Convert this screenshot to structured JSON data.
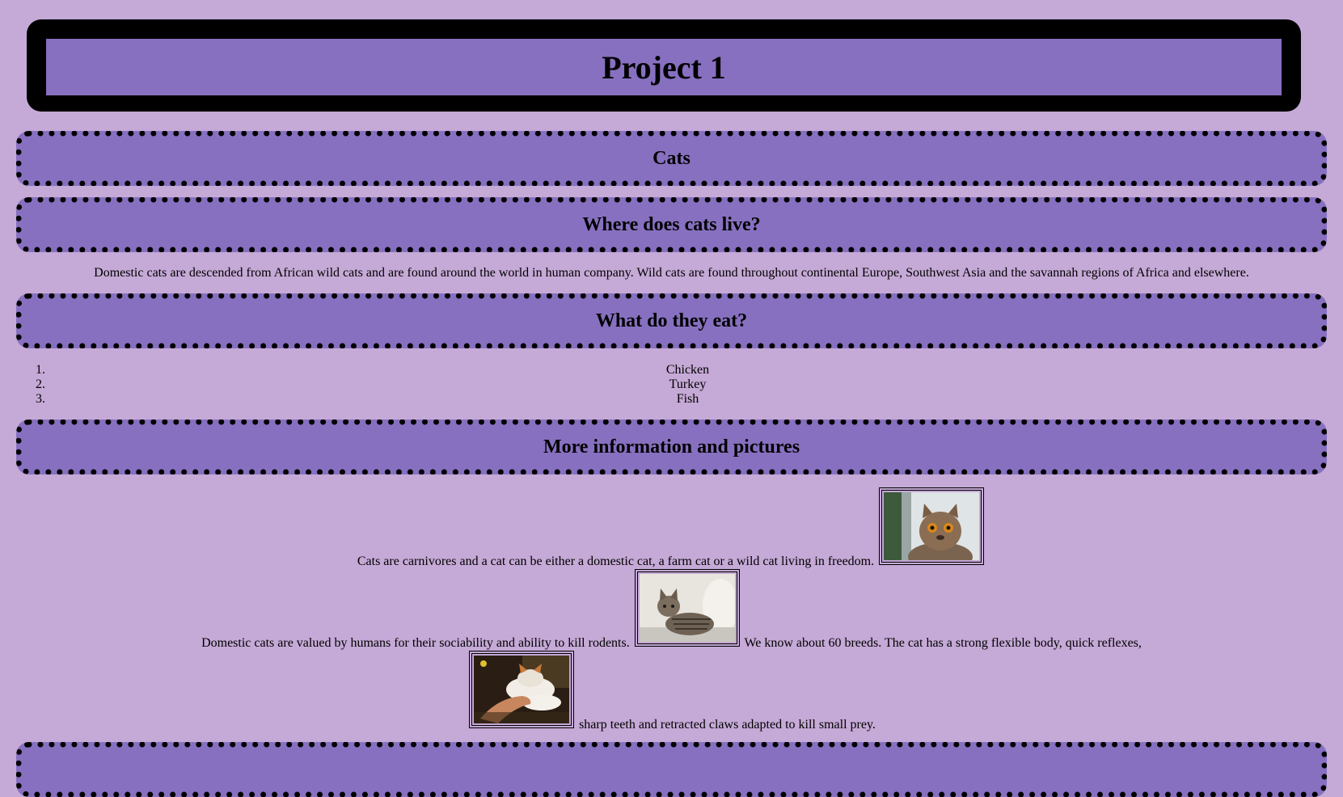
{
  "header": {
    "title": "Project 1"
  },
  "sections": {
    "cats": "Cats",
    "where": "Where does cats live?",
    "eat": "What do they eat?",
    "more": "More information and pictures"
  },
  "where_text": "Domestic cats are descended from African wild cats and are found around the world in human company. Wild cats are found throughout continental Europe, Southwest Asia and the savannah regions of Africa and elsewhere.",
  "food_list": [
    "Chicken",
    "Turkey",
    "Fish"
  ],
  "info": {
    "line1": "Cats are carnivores and a cat can be either a domestic cat, a farm cat or a wild cat living in freedom.",
    "line2a": "Domestic cats are valued by humans for their sociability and ability to kill rodents.",
    "line2b": "We know about 60 breeds. The cat has a strong flexible body, quick reflexes,",
    "line3": "sharp teeth and retracted claws adapted to kill small prey."
  },
  "colors": {
    "background": "#c5a9d6",
    "bar": "#8770c0",
    "border": "#000000"
  }
}
